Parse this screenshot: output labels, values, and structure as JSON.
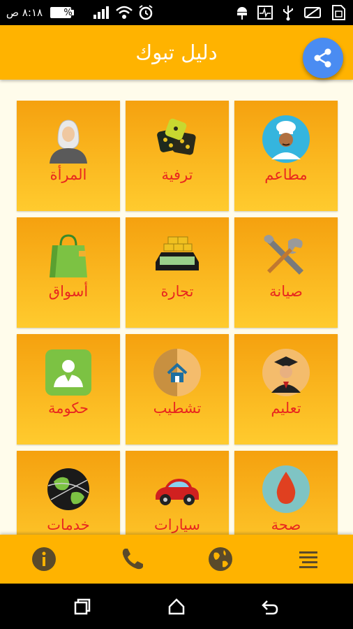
{
  "status_bar": {
    "time": "٨:١٨ ص",
    "battery": "%١٠٠",
    "icons": [
      "alarm-icon",
      "wifi-icon",
      "signal-icon",
      "battery-icon",
      "android-debug-icon",
      "pulse-monitor-icon",
      "usb-icon",
      "no-sim-icon",
      "sim-icon"
    ]
  },
  "app_bar": {
    "title": "دليل تبوك",
    "share_icon": "share-icon",
    "color": "#FFB300"
  },
  "share_button": {
    "color": "#4A8CF2"
  },
  "grid": {
    "tiles": [
      {
        "label": "مطاعم",
        "icon": "chef-icon"
      },
      {
        "label": "ترفية",
        "icon": "dice-icon"
      },
      {
        "label": "المرأة",
        "icon": "woman-icon"
      },
      {
        "label": "صيانة",
        "icon": "tools-icon"
      },
      {
        "label": "تجارة",
        "icon": "money-icon"
      },
      {
        "label": "أسواق",
        "icon": "shopping-bag-icon"
      },
      {
        "label": "تعليم",
        "icon": "graduate-icon"
      },
      {
        "label": "تشطيب",
        "icon": "home-finishing-icon"
      },
      {
        "label": "حكومة",
        "icon": "government-user-icon"
      },
      {
        "label": "صحة",
        "icon": "blood-drop-icon"
      },
      {
        "label": "سيارات",
        "icon": "car-icon"
      },
      {
        "label": "خدمات",
        "icon": "globe-network-icon"
      }
    ],
    "label_color": "#E8271F"
  },
  "bottom_bar": {
    "items": [
      "menu-icon",
      "globe-icon",
      "phone-icon",
      "info-icon"
    ]
  },
  "nav_bar": {
    "items": [
      "back-icon",
      "home-icon",
      "recents-icon"
    ]
  }
}
